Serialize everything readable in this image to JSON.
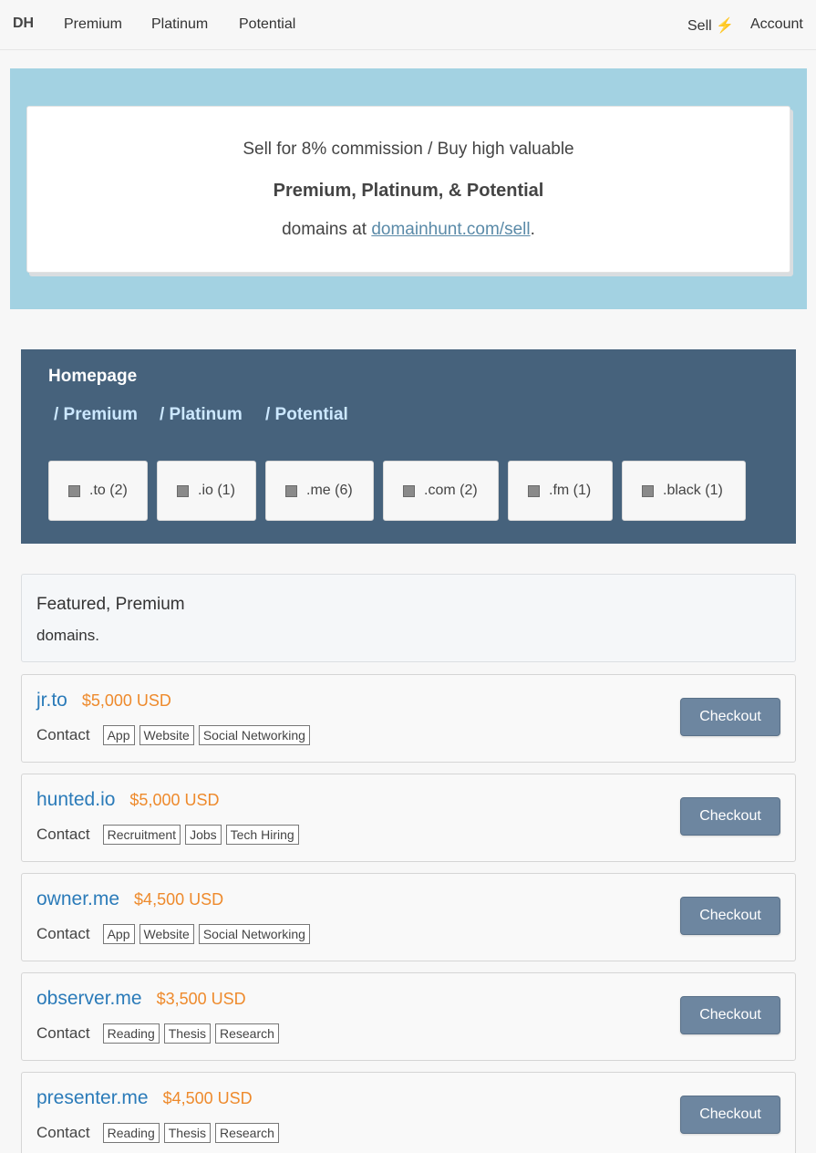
{
  "nav": {
    "brand": "DH",
    "links": [
      "Premium",
      "Platinum",
      "Potential"
    ],
    "sell": "Sell",
    "sell_icon": "lightning-icon",
    "account": "Account"
  },
  "hero": {
    "line1": "Sell for 8% commission / Buy high valuable",
    "line2": "Premium,  Platinum,  &  Potential",
    "line3_prefix": "domains at ",
    "link": "domainhunt.com/sell",
    "line3_suffix": "."
  },
  "filter": {
    "home": "Homepage",
    "crumbs": [
      "/ Premium",
      "/ Platinum",
      "/ Potential"
    ],
    "tlds": [
      ".to (2)",
      ".io (1)",
      ".me (6)",
      ".com (2)",
      ".fm (1)",
      ".black (1)"
    ]
  },
  "featured": {
    "title": "Featured, Premium",
    "subtitle": "domains."
  },
  "listings": [
    {
      "name": "jr.to",
      "price": "$5,000 USD",
      "contact": "Contact",
      "tags": [
        "App",
        "Website",
        "Social Networking"
      ],
      "button": "Checkout"
    },
    {
      "name": "hunted.io",
      "price": "$5,000 USD",
      "contact": "Contact",
      "tags": [
        "Recruitment",
        "Jobs",
        "Tech Hiring"
      ],
      "button": "Checkout"
    },
    {
      "name": "owner.me",
      "price": "$4,500 USD",
      "contact": "Contact",
      "tags": [
        "App",
        "Website",
        "Social Networking"
      ],
      "button": "Checkout"
    },
    {
      "name": "observer.me",
      "price": "$3,500 USD",
      "contact": "Contact",
      "tags": [
        "Reading",
        "Thesis",
        "Research"
      ],
      "button": "Checkout"
    },
    {
      "name": "presenter.me",
      "price": "$4,500 USD",
      "contact": "Contact",
      "tags": [
        "Reading",
        "Thesis",
        "Research"
      ],
      "button": "Checkout"
    }
  ]
}
